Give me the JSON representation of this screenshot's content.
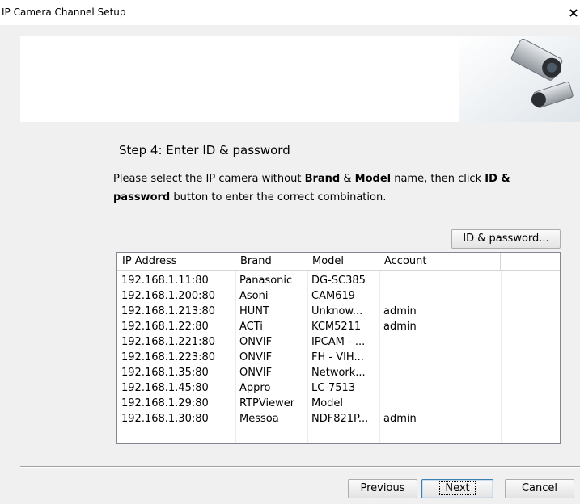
{
  "window": {
    "title": "IP Camera Channel Setup",
    "close_label": "×"
  },
  "step": {
    "title": "Step 4: Enter ID & password",
    "text_1": "Please select the IP camera without ",
    "bold_brand": "Brand",
    "text_2": " & ",
    "bold_model": "Model",
    "text_3": " name, then  click ",
    "bold_idpw": "ID & password",
    "text_4": " button to enter the correct combination."
  },
  "id_password_button": "ID & password...",
  "table": {
    "columns": [
      "IP Address",
      "Brand",
      "Model",
      "Account",
      ""
    ],
    "rows": [
      {
        "ip": "192.168.1.11:80",
        "brand": "Panasonic",
        "model": "DG-SC385",
        "account": ""
      },
      {
        "ip": "192.168.1.200:80",
        "brand": "Asoni",
        "model": "CAM619",
        "account": ""
      },
      {
        "ip": "192.168.1.213:80",
        "brand": "HUNT",
        "model": "Unknow...",
        "account": "admin"
      },
      {
        "ip": "192.168.1.22:80",
        "brand": "ACTi",
        "model": "KCM5211",
        "account": "admin"
      },
      {
        "ip": "192.168.1.221:80",
        "brand": "ONVIF",
        "model": "IPCAM - ...",
        "account": ""
      },
      {
        "ip": "192.168.1.223:80",
        "brand": "ONVIF",
        "model": "FH - VIH...",
        "account": ""
      },
      {
        "ip": "192.168.1.35:80",
        "brand": "ONVIF",
        "model": "Network...",
        "account": ""
      },
      {
        "ip": "192.168.1.45:80",
        "brand": "Appro",
        "model": "LC-7513",
        "account": ""
      },
      {
        "ip": "192.168.1.29:80",
        "brand": "RTPViewer",
        "model": "Model",
        "account": ""
      },
      {
        "ip": "192.168.1.30:80",
        "brand": "Messoa",
        "model": "NDF821P...",
        "account": "admin"
      }
    ]
  },
  "footer": {
    "previous": "Previous",
    "next": "Next",
    "cancel": "Cancel"
  },
  "icons": {
    "banner_art": "ip-camera-icon",
    "close": "close-icon"
  }
}
